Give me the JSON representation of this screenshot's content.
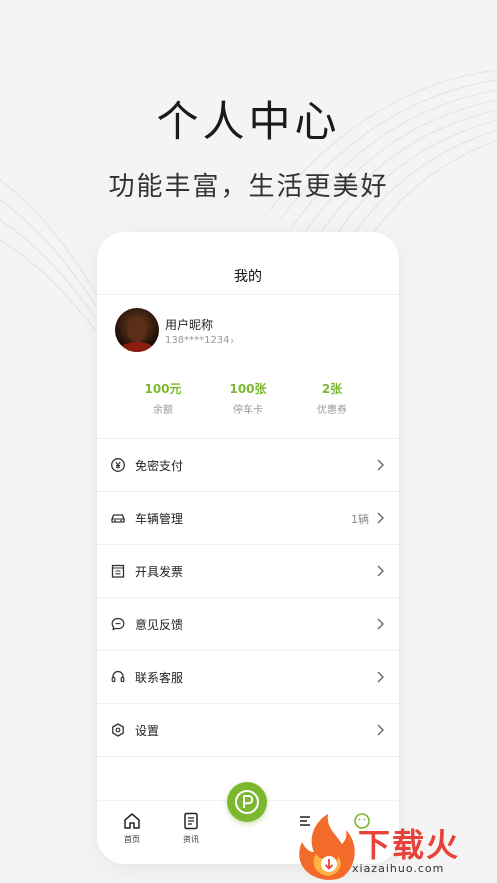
{
  "promo": {
    "headline": "个人中心",
    "subline": "功能丰富，生活更美好"
  },
  "screen": {
    "title": "我的",
    "user": {
      "nickname": "用户昵称",
      "phone": "138****1234"
    },
    "stats": [
      {
        "value": "100元",
        "label": "余额"
      },
      {
        "value": "100张",
        "label": "停车卡"
      },
      {
        "value": "2张",
        "label": "优惠券"
      }
    ],
    "menu": [
      {
        "label": "免密支付",
        "value": "",
        "icon": "yuan-circle-icon"
      },
      {
        "label": "车辆管理",
        "value": "1辆",
        "icon": "car-icon"
      },
      {
        "label": "开具发票",
        "value": "",
        "icon": "invoice-icon"
      },
      {
        "label": "意见反馈",
        "value": "",
        "icon": "chat-bubble-icon"
      },
      {
        "label": "联系客服",
        "value": "",
        "icon": "headset-icon"
      },
      {
        "label": "设置",
        "value": "",
        "icon": "settings-hexagon-icon"
      }
    ],
    "tabbar": [
      {
        "label": "首页",
        "icon": "home-icon"
      },
      {
        "label": "资讯",
        "icon": "news-icon"
      }
    ],
    "center_button": {
      "icon": "parking-p-icon"
    }
  },
  "watermark": {
    "text": "下载火",
    "url": "xiazaihuo.com"
  },
  "colors": {
    "accent": "#7cb82f",
    "watermark": "#e8433a"
  }
}
